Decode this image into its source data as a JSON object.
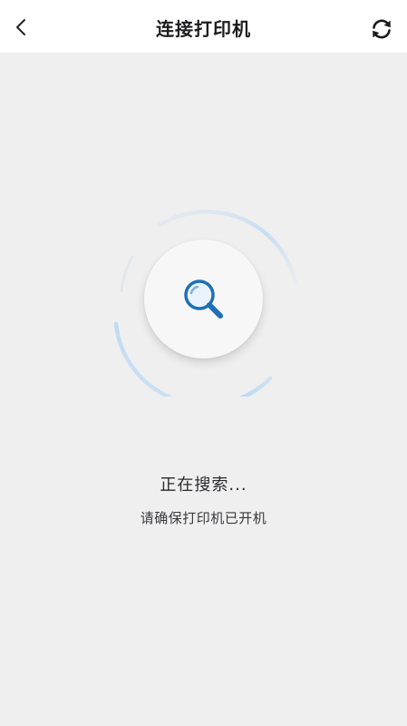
{
  "header": {
    "title": "连接打印机",
    "back_icon": "chevron-left-icon",
    "refresh_icon": "refresh-icon"
  },
  "scanner": {
    "center_icon": "search-icon",
    "ring_color": "#c7e0f6",
    "icon_color": "#1e6fb6"
  },
  "status": {
    "searching_label": "正在搜索...",
    "hint": "请确保打印机已开机"
  },
  "colors": {
    "background": "#efeff0",
    "header_background": "#ffffff"
  }
}
